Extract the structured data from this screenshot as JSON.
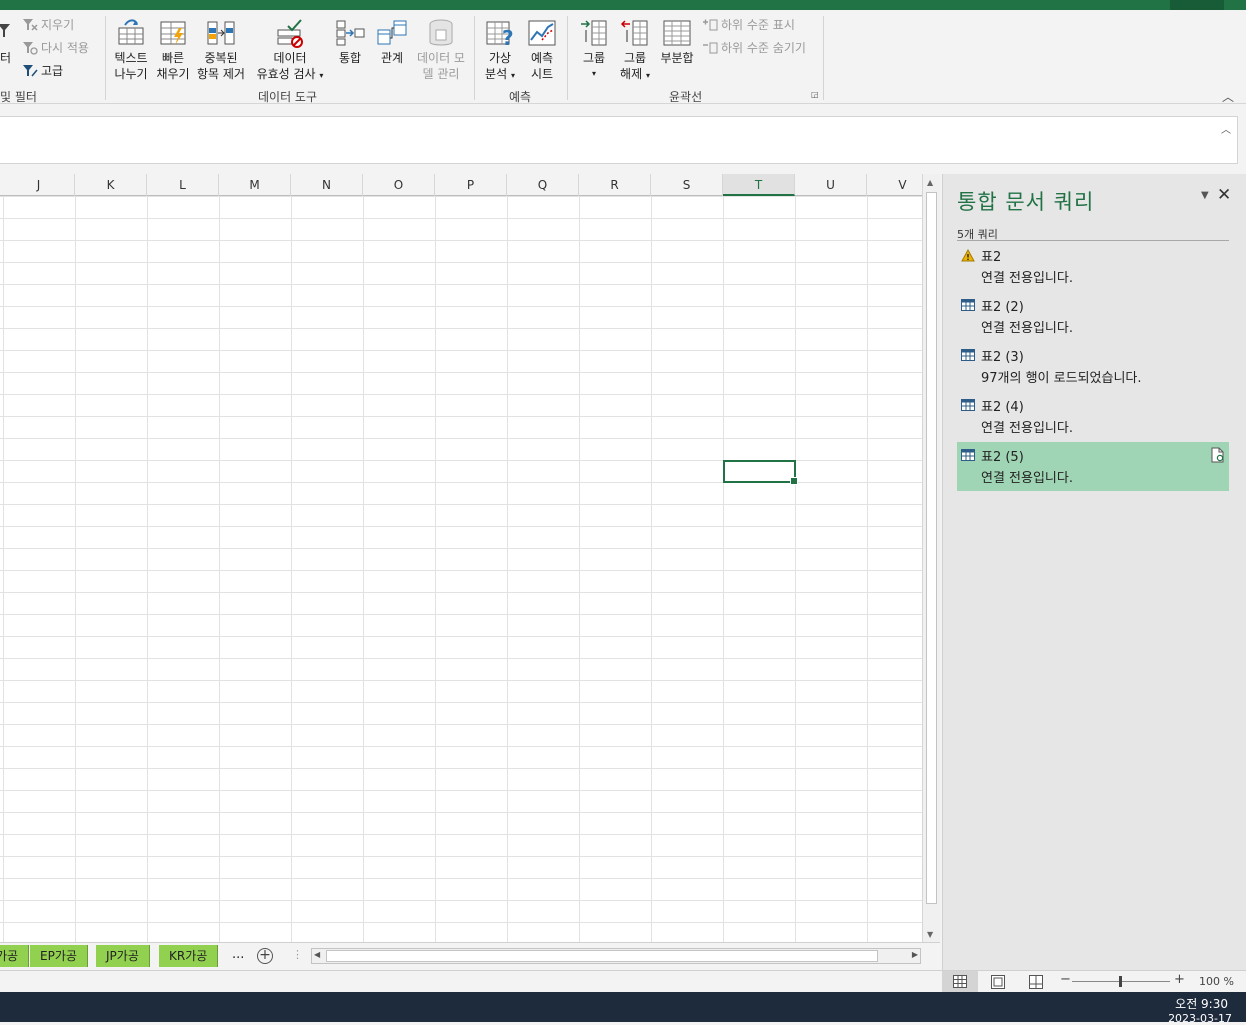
{
  "ribbon": {
    "filter_partial": "터",
    "sort_filter_partial": "및 필터",
    "clear": "지우기",
    "reapply": "다시 적용",
    "advanced": "고급",
    "text_to_columns": [
      "텍스트",
      "나누기"
    ],
    "flash_fill": [
      "빠른",
      "채우기"
    ],
    "remove_duplicates": [
      "중복된",
      "항목 제거"
    ],
    "data_validation": [
      "데이터",
      "유효성 검사"
    ],
    "consolidate": "통합",
    "relationships": "관계",
    "data_model": [
      "데이터 모",
      "델 관리"
    ],
    "data_tools": "데이터 도구",
    "what_if": [
      "가상",
      "분석"
    ],
    "forecast_sheet": [
      "예측",
      "시트"
    ],
    "forecast": "예측",
    "group": "그룹",
    "ungroup": [
      "그룹",
      "해제"
    ],
    "subtotal": "부분합",
    "show_detail": "하위 수준 표시",
    "hide_detail": "하위 수준 숨기기",
    "outline": "윤곽선"
  },
  "columns": [
    "J",
    "K",
    "L",
    "M",
    "N",
    "O",
    "P",
    "Q",
    "R",
    "S",
    "T",
    "U",
    "V"
  ],
  "active_column": "T",
  "sheets": [
    "가공",
    "EP가공",
    "JP가공",
    "KR가공"
  ],
  "sheet_more": "...",
  "pane": {
    "title": "통합 문서 쿼리",
    "count": "5개 쿼리",
    "queries": [
      {
        "name": "표2",
        "status": "연결 전용입니다.",
        "icon": "warning-icon"
      },
      {
        "name": "표2 (2)",
        "status": "연결 전용입니다.",
        "icon": "table-icon"
      },
      {
        "name": "표2 (3)",
        "status": "97개의 행이 로드되었습니다.",
        "icon": "table-icon"
      },
      {
        "name": "표2 (4)",
        "status": "연결 전용입니다.",
        "icon": "table-icon"
      },
      {
        "name": "표2 (5)",
        "status": "연결 전용입니다.",
        "icon": "table-icon",
        "selected": true
      }
    ]
  },
  "status": {
    "zoom": "100 %"
  },
  "taskbar": {
    "time": "오전 9:30",
    "date": "2023-03-17"
  },
  "colors": {
    "accent": "#217346",
    "sheet_tab": "#92d050",
    "selected_query": "#9fd5b5"
  }
}
